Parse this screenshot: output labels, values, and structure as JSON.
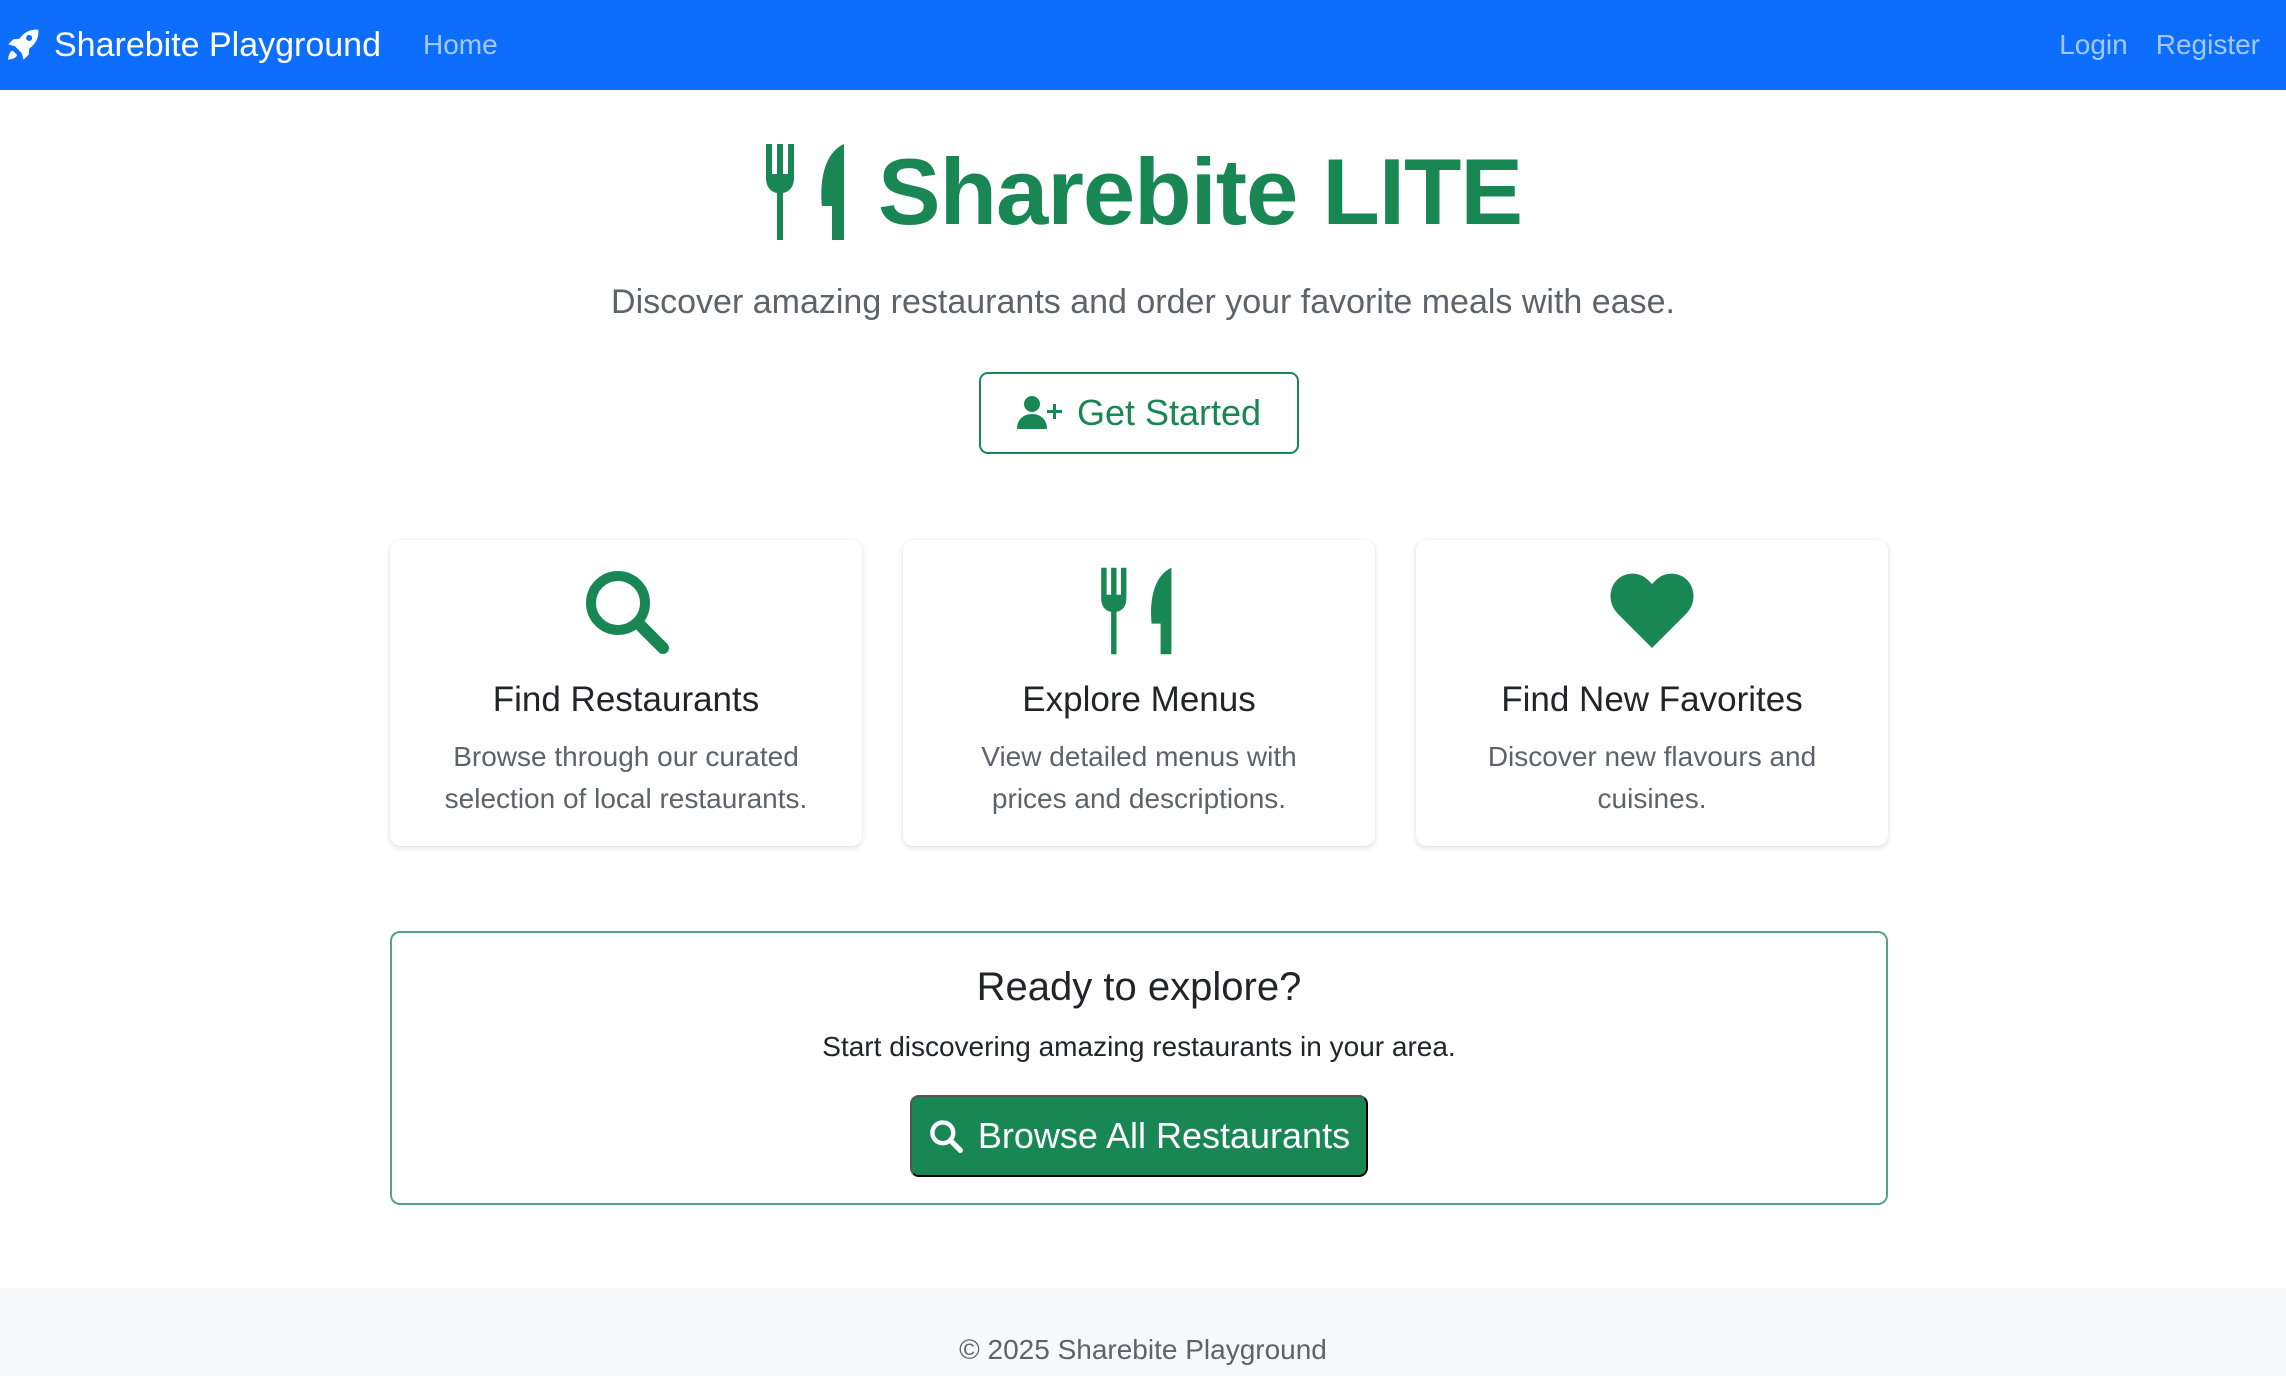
{
  "navbar": {
    "brand": "Sharebite Playground",
    "brand_icon": "rocket-icon",
    "links": {
      "home": "Home",
      "login": "Login",
      "register": "Register"
    },
    "color": "#0d6efd"
  },
  "hero": {
    "title": "Sharebite LITE",
    "title_icon": "utensils-icon",
    "subtitle": "Discover amazing restaurants and order your favorite meals with ease.",
    "cta_label": "Get Started",
    "cta_icon": "user-plus-icon",
    "accent": "#198754"
  },
  "features": [
    {
      "icon": "search-icon",
      "title": "Find Restaurants",
      "text": "Browse through our curated selection of local restaurants."
    },
    {
      "icon": "utensils-icon",
      "title": "Explore Menus",
      "text": "View detailed menus with prices and descriptions."
    },
    {
      "icon": "heart-icon",
      "title": "Find New Favorites",
      "text": "Discover new flavours and cuisines."
    }
  ],
  "cta": {
    "title": "Ready to explore?",
    "text": "Start discovering amazing restaurants in your area.",
    "button_label": "Browse All Restaurants",
    "button_icon": "search-icon"
  },
  "footer": {
    "text": "© 2025 Sharebite Playground"
  }
}
